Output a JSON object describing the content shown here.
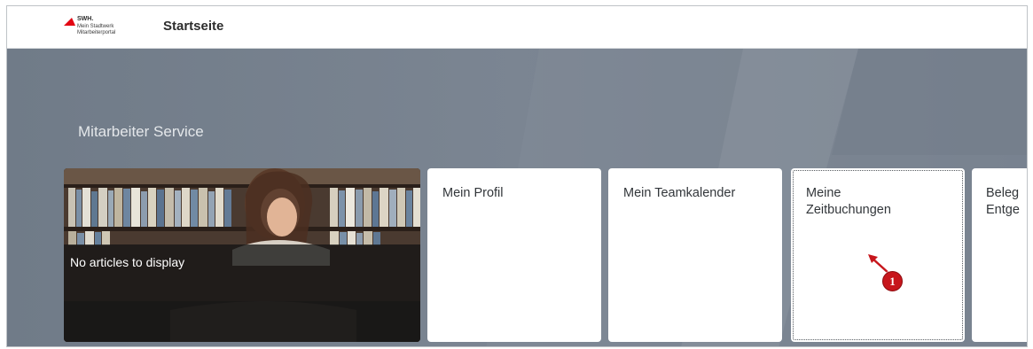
{
  "header": {
    "logo": {
      "line1": "SWH.",
      "line2": "Mein Stadtwerk",
      "line3": "Mitarbeiterportal",
      "brand_color": "#e30613"
    },
    "title": "Startseite"
  },
  "section": {
    "title": "Mitarbeiter Service"
  },
  "news_tile": {
    "message": "No articles to display"
  },
  "tiles": [
    {
      "title": "Mein Profil"
    },
    {
      "title": "Mein Teamkalender"
    },
    {
      "title": "Meine\nZeitbuchungen"
    },
    {
      "title": "Beleg\nEntge"
    }
  ],
  "annotation": {
    "marker_number": "1",
    "marker_color": "#c7161c"
  }
}
